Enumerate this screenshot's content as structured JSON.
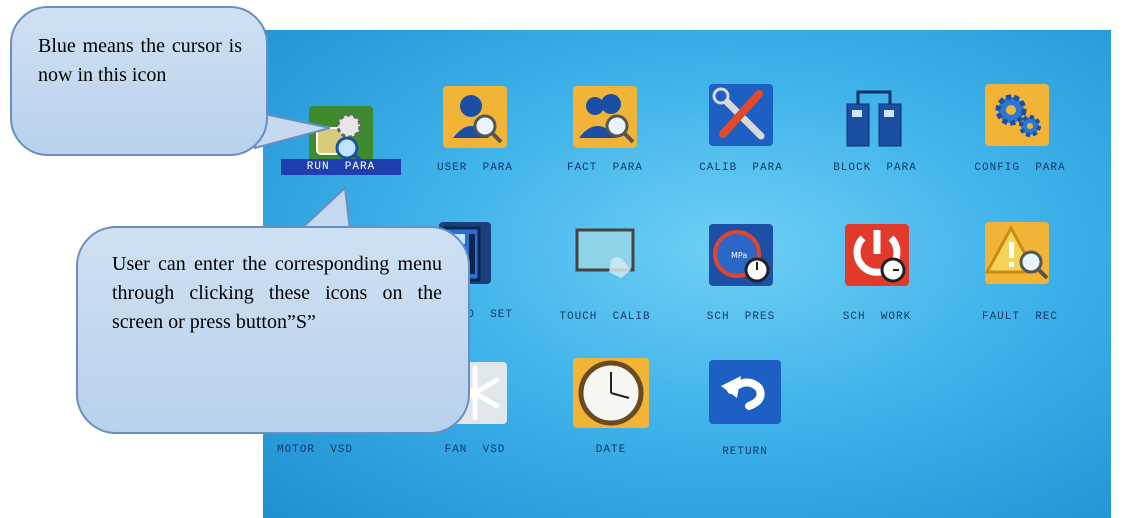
{
  "menu": {
    "items": [
      {
        "label": "RUN  PARA",
        "icon": "run-para-icon",
        "selected": true
      },
      {
        "label": "USER  PARA",
        "icon": "user-para-icon"
      },
      {
        "label": "FACT  PARA",
        "icon": "fact-para-icon"
      },
      {
        "label": "CALIB  PARA",
        "icon": "calib-para-icon"
      },
      {
        "label": "BLOCK  PARA",
        "icon": "block-para-icon"
      },
      {
        "label": "CONFIG  PARA",
        "icon": "config-para-icon"
      },
      {
        "label": "D  SET",
        "icon": "set-icon"
      },
      {
        "label": "TOUCH  CALIB",
        "icon": "touch-calib-icon"
      },
      {
        "label": "SCH  PRES",
        "icon": "sch-pres-icon"
      },
      {
        "label": "SCH  WORK",
        "icon": "sch-work-icon"
      },
      {
        "label": "FAULT  REC",
        "icon": "fault-rec-icon"
      },
      {
        "label": "MOTOR  VSD",
        "icon": "motor-vsd-icon"
      },
      {
        "label": "FAN  VSD",
        "icon": "fan-vsd-icon"
      },
      {
        "label": "DATE",
        "icon": "date-icon"
      },
      {
        "label": "RETURN",
        "icon": "return-icon"
      }
    ]
  },
  "callouts": {
    "cursor_note": "Blue means the cursor is now in this icon",
    "usage_note": "User can enter the corresponding menu through clicking these icons on the screen or press button”S”"
  },
  "colors": {
    "screen_bg": "#3fb3ea",
    "selection": "#1f3fae",
    "callout_fill": "#c5d9f0",
    "callout_border": "#6a8ec2"
  }
}
